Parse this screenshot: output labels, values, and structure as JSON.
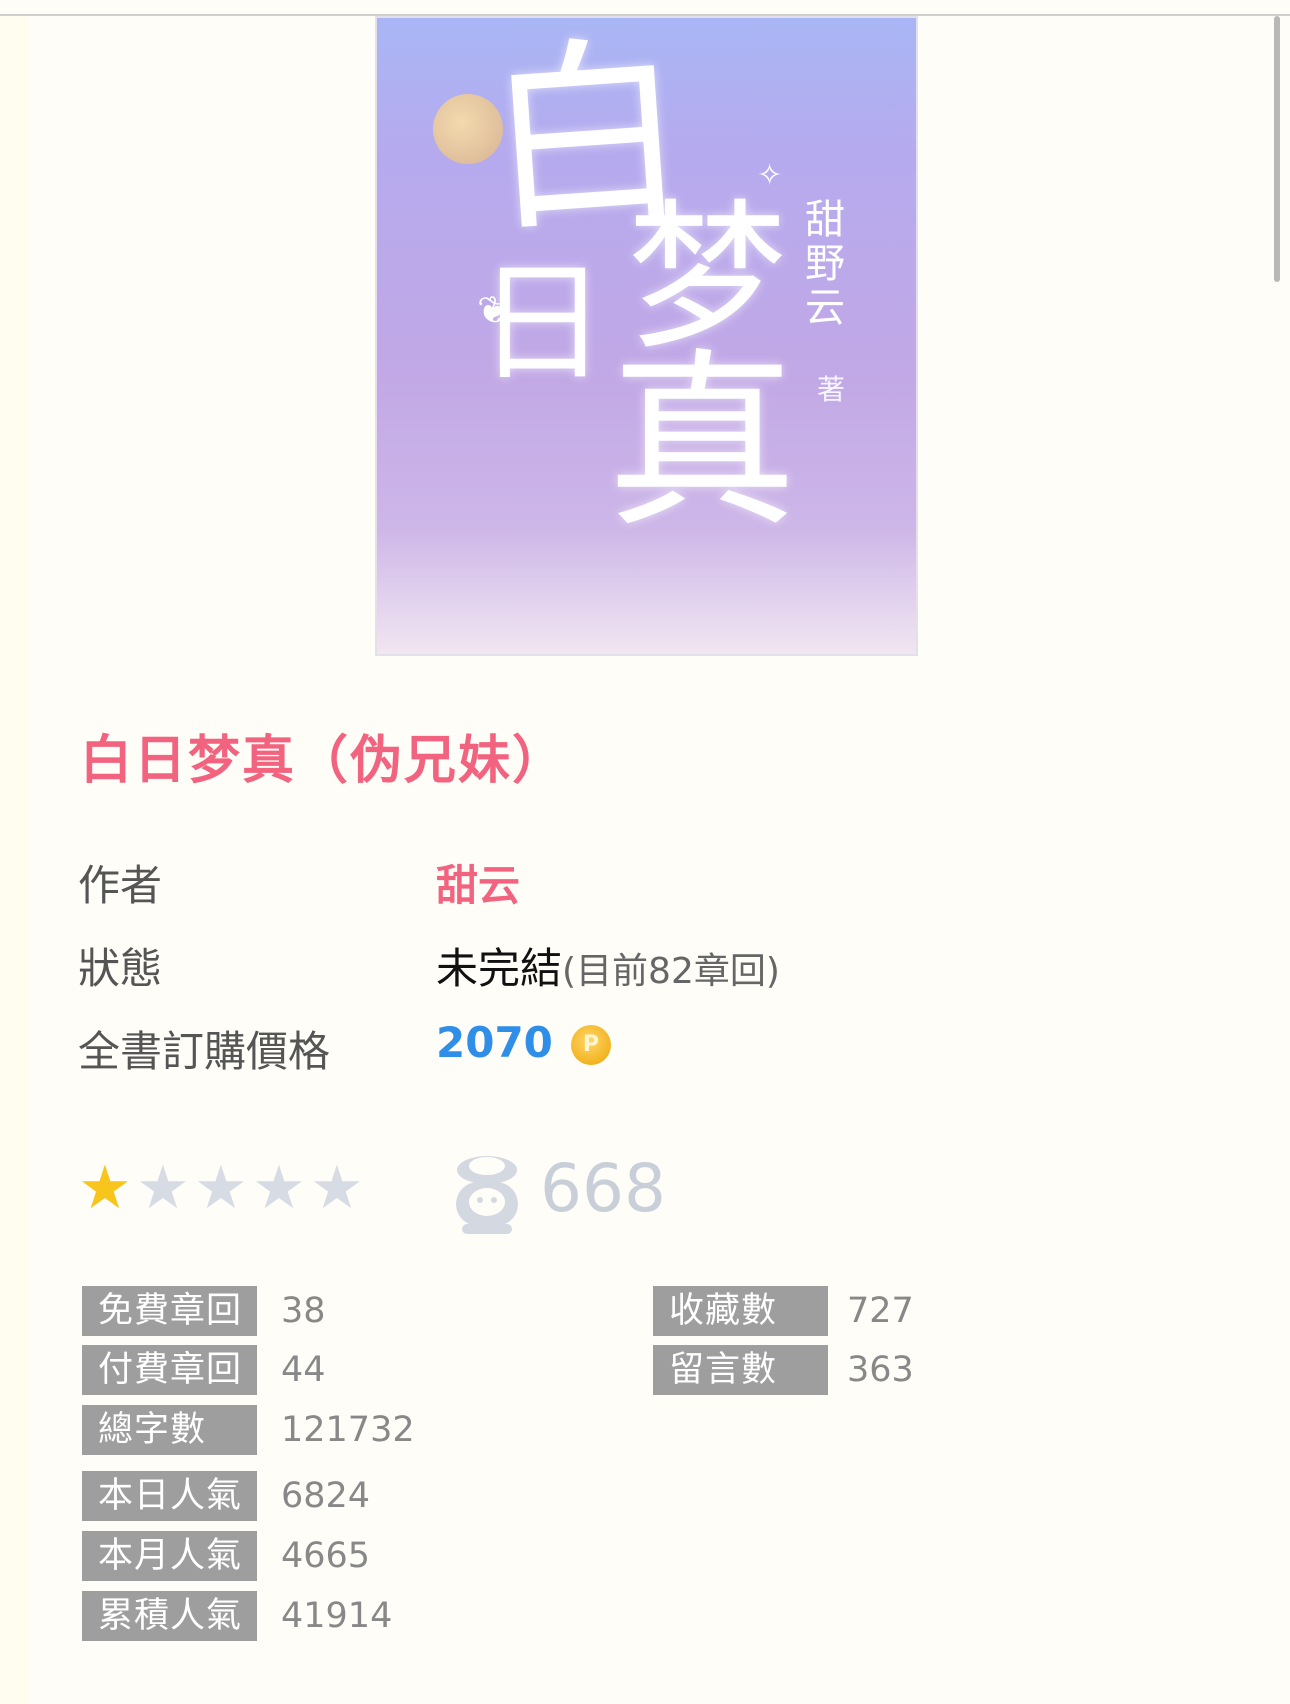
{
  "cover": {
    "title_chars": [
      "白",
      "日",
      "梦",
      "真"
    ],
    "author": "甜野云",
    "zhu": "著"
  },
  "book": {
    "title": "白日梦真（伪兄妹）"
  },
  "info": {
    "author_label": "作者",
    "author_value": "甜云",
    "status_label": "狀態",
    "status_value": "未完結",
    "status_detail": "(目前82章回)",
    "price_label": "全書訂購價格",
    "price_value": "2070",
    "coin_symbol": "P"
  },
  "rating": {
    "stars_filled": 1,
    "stars_total": 5,
    "likes_count": "668"
  },
  "stats_left": [
    {
      "label": "免費章回",
      "value": "38"
    },
    {
      "label": "付費章回",
      "value": "44"
    },
    {
      "label": "總字數",
      "value": "121732"
    },
    {
      "label": "本日人氣",
      "value": "6824"
    },
    {
      "label": "本月人氣",
      "value": "4665"
    },
    {
      "label": "累積人氣",
      "value": "41914"
    }
  ],
  "stats_right": [
    {
      "label": "收藏數",
      "value": "727"
    },
    {
      "label": "留言數",
      "value": "363"
    }
  ],
  "colors": {
    "accent": "#f2637f",
    "price": "#2f8fe8",
    "star_on": "#f7c51b",
    "star_off": "#d7dce4",
    "label_bg": "#9e9e9e"
  }
}
